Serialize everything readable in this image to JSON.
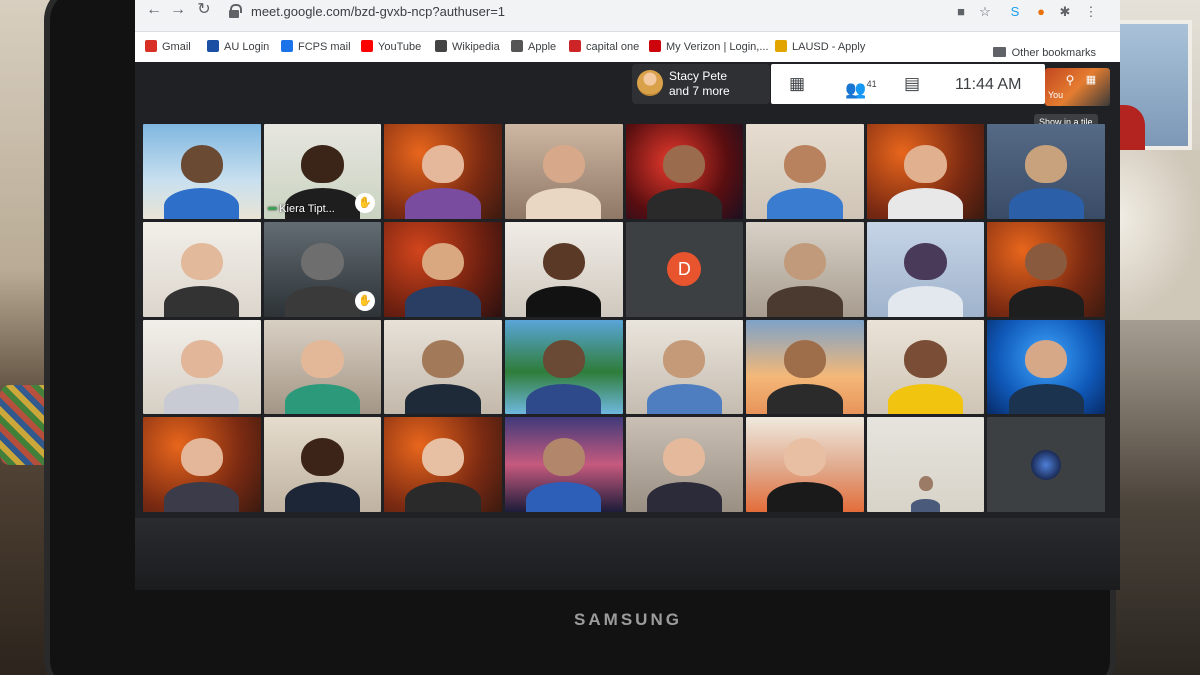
{
  "browser": {
    "url": "meet.google.com/bzd-gvxb-ncp?authuser=1",
    "bookmarks": [
      {
        "label": "Gmail",
        "icon": "gmail-icon",
        "color": "#d93025"
      },
      {
        "label": "AU Login",
        "icon": "au-icon",
        "color": "#1a4fa3"
      },
      {
        "label": "FCPS mail",
        "icon": "mail-icon",
        "color": "#1a73e8"
      },
      {
        "label": "YouTube",
        "icon": "youtube-icon",
        "color": "#ff0000"
      },
      {
        "label": "Wikipedia",
        "icon": "wikipedia-icon",
        "color": "#444444"
      },
      {
        "label": "Apple",
        "icon": "apple-icon",
        "color": "#555555"
      },
      {
        "label": "capital one",
        "icon": "capital-one-icon",
        "color": "#cc2427"
      },
      {
        "label": "My Verizon | Login,...",
        "icon": "verizon-icon",
        "color": "#cd040b"
      },
      {
        "label": "LAUSD - Apply",
        "icon": "lausd-icon",
        "color": "#e2a400"
      }
    ],
    "other_bookmarks": "Other bookmarks"
  },
  "meet": {
    "presenter": {
      "name": "Stacy Pete",
      "more": "and 7 more"
    },
    "participants_count": "41",
    "time": "11:44 AM",
    "self_label": "You",
    "tooltip": "Show in a tile"
  },
  "tiles": [
    {
      "bg": "linear-gradient(180deg,#7fb7e0,#c9e0ef 60%,#e9e4d5)",
      "skin": "#6b4a34",
      "shirt": "#2d6fc9"
    },
    {
      "bg": "linear-gradient(180deg,#e7e6e0,#c9d3c0)",
      "skin": "#3b2519",
      "shirt": "#1e1e1e",
      "name": "Kiera Tipt...",
      "hand": true,
      "speaking": true
    },
    {
      "bg": "radial-gradient(circle at 30% 30%,#e8661c,#7b2a12 60%,#3a1a10)",
      "skin": "#e6b89b",
      "shirt": "#7a4ca0"
    },
    {
      "bg": "linear-gradient(180deg,#cdb7a2,#8f7866)",
      "skin": "#d8a88a",
      "shirt": "#e9d7c4"
    },
    {
      "bg": "radial-gradient(circle at 40% 40%,#e83a2c,#5a0e10 60%,#1a1020)",
      "skin": "#9a6b4d",
      "shirt": "#2a2a2a"
    },
    {
      "bg": "linear-gradient(180deg,#e6ddd0,#cfc4b5)",
      "skin": "#b9825e",
      "shirt": "#3a7cd0"
    },
    {
      "bg": "radial-gradient(circle at 30% 30%,#e8661c,#7b2a12 60%,#3a1a10)",
      "skin": "#e0b08f",
      "shirt": "#e8e8e8"
    },
    {
      "bg": "linear-gradient(180deg,#556a86,#3a4b66)",
      "skin": "#c7a27d",
      "shirt": "#2b5fa8"
    },
    {
      "bg": "linear-gradient(180deg,#f2efe9,#dcd5cc)",
      "skin": "#e2b99a",
      "shirt": "#333333"
    },
    {
      "bg": "linear-gradient(180deg,#626c72,#2d3337)",
      "skin": "#6e6e6e",
      "shirt": "#3a3a3a",
      "hand": true
    },
    {
      "bg": "radial-gradient(circle at 30% 30%,#d2451c,#6e2010 60%,#2a1010)",
      "skin": "#d9a880",
      "shirt": "#2a3d63"
    },
    {
      "bg": "linear-gradient(180deg,#f0ece6,#cfc8be)",
      "skin": "#5a3a26",
      "shirt": "#121212"
    },
    {
      "bg": "#3c4043",
      "letter": "D"
    },
    {
      "bg": "linear-gradient(180deg,#d8d1c7,#a79c8e)",
      "skin": "#c09a7a",
      "shirt": "#4a3a30"
    },
    {
      "bg": "linear-gradient(180deg,#c6d4e6,#9fb3cc)",
      "skin": "#4a3a5a",
      "shirt": "#e3e8ee"
    },
    {
      "bg": "radial-gradient(circle at 30% 30%,#e8661c,#7b2a12 60%,#3a1a10)",
      "skin": "#8a5a3e",
      "shirt": "#1e1e1e"
    },
    {
      "bg": "linear-gradient(180deg,#f2efea,#d6cfc4)",
      "skin": "#e1b699",
      "shirt": "#c9cbd4"
    },
    {
      "bg": "linear-gradient(180deg,#d8cfc3,#a49686)",
      "skin": "#e2b899",
      "shirt": "#2c9a7a"
    },
    {
      "bg": "linear-gradient(180deg,#e7e1d8,#c3b9ab)",
      "skin": "#a27a5a",
      "shirt": "#1f2a38"
    },
    {
      "bg": "linear-gradient(180deg,#59a5d8,#2f7d3a 55%,#6fb8e0)",
      "skin": "#6a4a34",
      "shirt": "#2f4a8a"
    },
    {
      "bg": "linear-gradient(180deg,#e9e4dc,#c5bcb0)",
      "skin": "#c49a78",
      "shirt": "#4f7ec0"
    },
    {
      "bg": "linear-gradient(180deg,#7ea2c8,#f4b878 60%,#e8945a)",
      "skin": "#9e6d4a",
      "shirt": "#2b2b2b"
    },
    {
      "bg": "linear-gradient(180deg,#e9e2d6,#cfc5b6)",
      "skin": "#7a4e36",
      "shirt": "#f1c40f"
    },
    {
      "bg": "radial-gradient(circle at 50% 40%,#3fa7ff,#0f58b8 60%,#082a66)",
      "skin": "#d6a888",
      "shirt": "#1c3350"
    },
    {
      "bg": "radial-gradient(circle at 30% 30%,#e8661c,#7b2a12 60%,#3a1a10)",
      "skin": "#e5b79a",
      "shirt": "#3b3b4a"
    },
    {
      "bg": "linear-gradient(180deg,#e5dccd,#bfb2a1)",
      "skin": "#3d2418",
      "shirt": "#1d2636"
    },
    {
      "bg": "radial-gradient(circle at 30% 30%,#e8661c,#7b2a12 60%,#3a1a10)",
      "skin": "#e7c0a3",
      "shirt": "#2a2a2a"
    },
    {
      "bg": "linear-gradient(180deg,#403a7a,#c65a7e 50%,#1c1c3a)",
      "skin": "#b1866a",
      "shirt": "#2e5fb8"
    },
    {
      "bg": "linear-gradient(180deg,#c9bfb4,#9a8f83)",
      "skin": "#e4b99c",
      "shirt": "#2b2b3a"
    },
    {
      "bg": "linear-gradient(180deg,#efe9de,#e0a88a 55%,#e46d3a)",
      "skin": "#e9bfa3",
      "shirt": "#1a1a1a"
    },
    {
      "bg": "linear-gradient(180deg,#e6e4de,#d8d3c8)",
      "skin": "#9b7a66",
      "shirt": "#4a5a7a",
      "small": true
    },
    {
      "bg": "#3c4043",
      "avatar": true
    }
  ]
}
